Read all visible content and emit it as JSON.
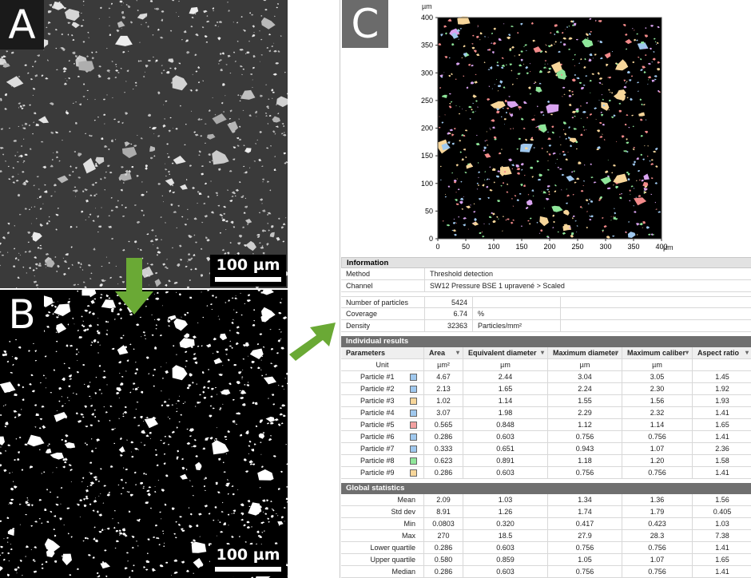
{
  "panels": {
    "a_label": "A",
    "b_label": "B",
    "c_label": "C",
    "scalebar_a": "100 µm",
    "scalebar_b": "100 µm"
  },
  "map": {
    "unit_label_x": "µm",
    "unit_label_y": "µm",
    "x_ticks": [
      "0",
      "50",
      "100",
      "150",
      "200",
      "250",
      "300",
      "350",
      "400"
    ],
    "y_ticks": [
      "400",
      "350",
      "300",
      "250",
      "200",
      "150",
      "100",
      "50",
      "0"
    ],
    "x_max": 400,
    "y_max": 400
  },
  "information": {
    "title": "Information",
    "rows": [
      {
        "key": "Method",
        "value": "Threshold detection"
      },
      {
        "key": "Channel",
        "value": "SW12 Pressure BSE 1 upravené > Scaled"
      }
    ]
  },
  "summary": [
    {
      "key": "Number of particles",
      "value": "5424",
      "unit": ""
    },
    {
      "key": "Coverage",
      "value": "6.74",
      "unit": "%"
    },
    {
      "key": "Density",
      "value": "32363",
      "unit": "Particles/mm²"
    }
  ],
  "individual": {
    "title": "Individual results",
    "headers": [
      "Parameters",
      "Area",
      "Equivalent diameter",
      "Maximum diameter",
      "Maximum caliber",
      "Aspect ratio"
    ],
    "units": [
      "Unit",
      "µm²",
      "µm",
      "µm",
      "µm",
      ""
    ],
    "rows": [
      {
        "name": "Particle #1",
        "color": "#9fc8ee",
        "vals": [
          "4.67",
          "2.44",
          "3.04",
          "3.05",
          "1.45"
        ]
      },
      {
        "name": "Particle #2",
        "color": "#9fc8ee",
        "vals": [
          "2.13",
          "1.65",
          "2.24",
          "2.30",
          "1.92"
        ]
      },
      {
        "name": "Particle #3",
        "color": "#f7d69a",
        "vals": [
          "1.02",
          "1.14",
          "1.55",
          "1.56",
          "1.93"
        ]
      },
      {
        "name": "Particle #4",
        "color": "#9fc8ee",
        "vals": [
          "3.07",
          "1.98",
          "2.29",
          "2.32",
          "1.41"
        ]
      },
      {
        "name": "Particle #5",
        "color": "#f2a0a0",
        "vals": [
          "0.565",
          "0.848",
          "1.12",
          "1.14",
          "1.65"
        ]
      },
      {
        "name": "Particle #6",
        "color": "#9fc8ee",
        "vals": [
          "0.286",
          "0.603",
          "0.756",
          "0.756",
          "1.41"
        ]
      },
      {
        "name": "Particle #7",
        "color": "#9fc8ee",
        "vals": [
          "0.333",
          "0.651",
          "0.943",
          "1.07",
          "2.36"
        ]
      },
      {
        "name": "Particle #8",
        "color": "#8fe69a",
        "vals": [
          "0.623",
          "0.891",
          "1.18",
          "1.20",
          "1.58"
        ]
      },
      {
        "name": "Particle #9",
        "color": "#f7d69a",
        "vals": [
          "0.286",
          "0.603",
          "0.756",
          "0.756",
          "1.41"
        ]
      }
    ]
  },
  "global": {
    "title": "Global statistics",
    "rows": [
      {
        "name": "Mean",
        "vals": [
          "2.09",
          "1.03",
          "1.34",
          "1.36",
          "1.56"
        ]
      },
      {
        "name": "Std dev",
        "vals": [
          "8.91",
          "1.26",
          "1.74",
          "1.79",
          "0.405"
        ]
      },
      {
        "name": "Min",
        "vals": [
          "0.0803",
          "0.320",
          "0.417",
          "0.423",
          "1.03"
        ]
      },
      {
        "name": "Max",
        "vals": [
          "270",
          "18.5",
          "27.9",
          "28.3",
          "7.38"
        ]
      },
      {
        "name": "Lower quartile",
        "vals": [
          "0.286",
          "0.603",
          "0.756",
          "0.756",
          "1.41"
        ]
      },
      {
        "name": "Upper quartile",
        "vals": [
          "0.580",
          "0.859",
          "1.05",
          "1.07",
          "1.65"
        ]
      },
      {
        "name": "Median",
        "vals": [
          "0.286",
          "0.603",
          "0.756",
          "0.756",
          "1.41"
        ]
      }
    ]
  },
  "colors": {
    "arrow": "#6aa935",
    "particle_colors": [
      "#f28a8a",
      "#8fe69a",
      "#9fc8ee",
      "#f7d69a",
      "#d9a3f0"
    ]
  }
}
